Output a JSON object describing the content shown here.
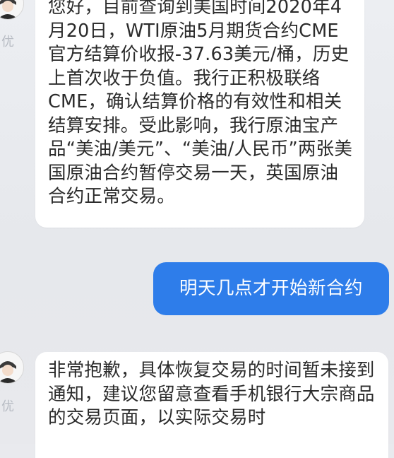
{
  "conversation": {
    "messages": [
      {
        "direction": "incoming",
        "sender_label": "优",
        "text": "您好，目前查询到美国时间2020年4月20日，WTI原油5月期货合约CME官方结算价收报-37.63美元/桶，历史上首次收于负值。我行正积极联络CME，确认结算价格的有效性和相关结算安排。受此影响，我行原油宝产品“美油/美元”、“美油/人民币”两张美国原油合约暂停交易一天，英国原油合约正常交易。"
      },
      {
        "direction": "outgoing",
        "text": "明天几点才开始新合约"
      },
      {
        "direction": "incoming",
        "sender_label": "优",
        "text": "非常抱歉，具体恢复交易的时间暂未接到通知，建议您留意查看手机银行大宗商品的交易页面，以实际交易时"
      }
    ]
  },
  "colors": {
    "background": "#e9eaee",
    "incoming_bubble": "#ffffff",
    "outgoing_bubble": "#2e7dea",
    "sender_label": "#b8bcc4"
  },
  "icons": {
    "avatar": "agent-avatar-icon"
  }
}
